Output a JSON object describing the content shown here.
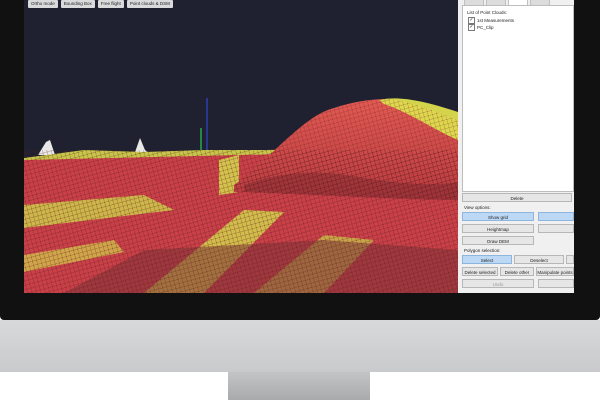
{
  "toolbar": {
    "buttons": [
      {
        "label": "Ortho mode"
      },
      {
        "label": "Bounding Box"
      },
      {
        "label": "Free flight"
      },
      {
        "label": "Point clouds & DSM"
      }
    ]
  },
  "panel": {
    "list_title": "List of Point Clouds:",
    "point_clouds": [
      {
        "label": "1st Measurements",
        "checked": true
      },
      {
        "label": "PC_Clip",
        "checked": true
      }
    ],
    "delete_label": "Delete",
    "view_options_label": "View options:",
    "view_buttons": {
      "show_grid": "Show grid",
      "heightmap": "Heightmap",
      "draw_dem": "Draw DEM"
    },
    "polygon_selection_label": "Polygon selection:",
    "polygon_buttons": {
      "select": "Select",
      "deselect": "Deselect",
      "delete_selected": "Delete selected",
      "delete_other": "Delete other",
      "manipulate_points": "Manipulate points",
      "undo": "Undo"
    }
  },
  "colors": {
    "point_red": "#d8434b",
    "point_yellow": "#dede4e",
    "sky": "#1f2130",
    "button_blue": "#bcd8f4"
  }
}
